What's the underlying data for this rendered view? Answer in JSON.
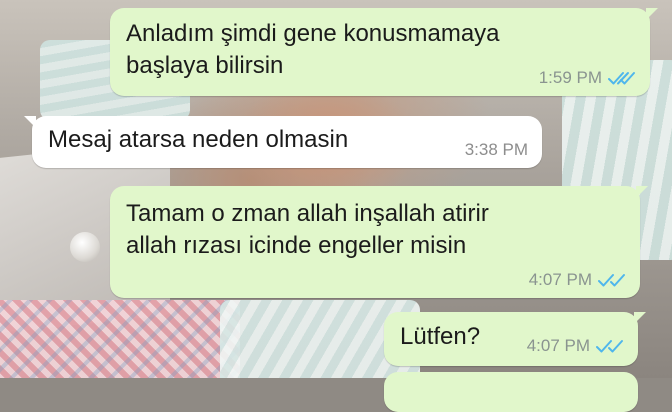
{
  "chat": {
    "messages": [
      {
        "direction": "outgoing",
        "text": "Anladım   şimdi gene konusmamaya\nbaşlaya bilirsin",
        "time": "1:59 PM",
        "status": "read"
      },
      {
        "direction": "incoming",
        "text": "Mesaj atarsa neden olmasin",
        "time": "3:38 PM"
      },
      {
        "direction": "outgoing",
        "text": "Tamam o zman allah inşallah  atirir\nallah rızası icinde engeller misin",
        "time": "4:07 PM",
        "status": "read"
      },
      {
        "direction": "outgoing",
        "text": "Lütfen?",
        "time": "4:07 PM",
        "status": "read"
      }
    ]
  },
  "colors": {
    "outgoing_bubble": "#e1f7cb",
    "incoming_bubble": "#ffffff",
    "read_ticks": "#4fb6ec"
  },
  "icons": {
    "read_receipt": "double-check-icon"
  }
}
